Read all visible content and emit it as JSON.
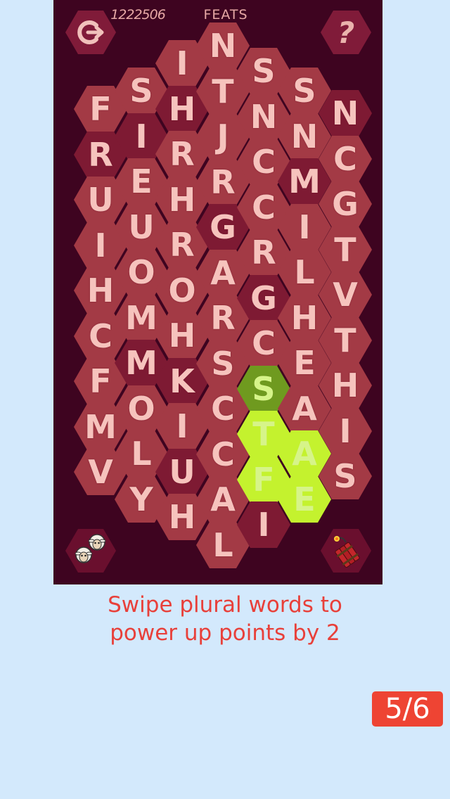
{
  "header": {
    "score": "1222506",
    "current_word": "FEATS"
  },
  "buttons": {
    "help_label": "?"
  },
  "colors": {
    "background": "#d3e9fc",
    "board": "#3e0420",
    "tile_normal": "#a33a45",
    "tile_dark": "#7e1a33",
    "tile_selected": "#c4f22e",
    "tile_selected_head": "#6f9a1f",
    "letter": "#f6c3bd",
    "caption": "#e8403a",
    "pager": "#ee4433"
  },
  "board": {
    "columns": [
      {
        "letters": [
          "F",
          "R",
          "U",
          "I",
          "H",
          "C",
          "F",
          "M",
          "V"
        ],
        "dark": [
          1
        ]
      },
      {
        "letters": [
          "S",
          "I",
          "E",
          "U",
          "O",
          "M",
          "M",
          "O",
          "L",
          "Y"
        ],
        "dark": [
          1,
          6
        ]
      },
      {
        "letters": [
          "I",
          "H",
          "R",
          "H",
          "R",
          "O",
          "H",
          "K",
          "I",
          "U",
          "H"
        ],
        "dark": [
          1,
          7,
          9
        ]
      },
      {
        "letters": [
          "N",
          "T",
          "J",
          "R",
          "G",
          "A",
          "R",
          "S",
          "C",
          "C",
          "A",
          "L"
        ],
        "dark": [
          4
        ]
      },
      {
        "letters": [
          "S",
          "N",
          "C",
          "C",
          "R",
          "G",
          "C",
          "S",
          "T",
          "F",
          "I"
        ],
        "dark": [
          5,
          10
        ],
        "selected": [
          7,
          8,
          9
        ],
        "head": 7
      },
      {
        "letters": [
          "S",
          "N",
          "M",
          "I",
          "L",
          "H",
          "E",
          "A",
          "A",
          "E"
        ],
        "dark": [
          2
        ],
        "selected": [
          8,
          9
        ]
      },
      {
        "letters": [
          "N",
          "C",
          "G",
          "T",
          "V",
          "T",
          "H",
          "I",
          "S"
        ],
        "dark": [
          0
        ]
      }
    ]
  },
  "caption": {
    "line1": "Swipe plural words to",
    "line2": "power up points by 2"
  },
  "pager": {
    "label": "5/6"
  }
}
